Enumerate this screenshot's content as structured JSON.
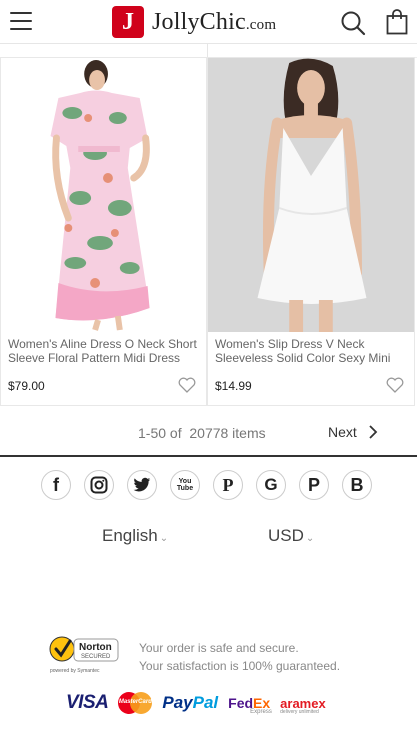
{
  "header": {
    "logo_badge": "J",
    "logo_text": "JollyChic",
    "logo_suffix": ".com",
    "icons": [
      "menu-icon",
      "search-icon",
      "bag-icon"
    ]
  },
  "products": [
    {
      "title": "Women's Aline Dress O Neck Short Sleeve Floral Pattern Midi Dress",
      "price": "$79.00"
    },
    {
      "title": "Women's Slip Dress V Neck Sleeveless Solid Color Sexy Mini Dress",
      "price": "$14.99"
    }
  ],
  "pager": {
    "count": "1-50 of  20778 items",
    "next": "Next"
  },
  "socials": [
    "f",
    "ig",
    "tw",
    "You Tube",
    "P",
    "G",
    "P",
    "B"
  ],
  "footer": {
    "language": "English",
    "currency": "USD",
    "norton_label": "Norton",
    "norton_sub": "SECURED",
    "norton_powered": "powered by Symantec",
    "secure_line1": "Your order is safe and secure.",
    "secure_line2": "Your satisfaction is 100% guaranteed.",
    "payments": {
      "visa": "VISA",
      "mastercard": "MasterCard",
      "paypal_a": "Pay",
      "paypal_b": "Pal",
      "fedex_a": "Fed",
      "fedex_b": "Ex",
      "fedex_sub": "Express",
      "aramex": "aramex",
      "aramex_sub": "delivery unlimited"
    }
  },
  "colors": {
    "brand_red": "#d0021b",
    "text": "#333333",
    "muted": "#888888"
  }
}
